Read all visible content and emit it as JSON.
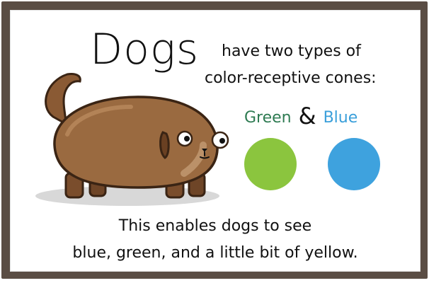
{
  "title": "Dogs",
  "subtitle_lines": [
    "have two types of",
    "color-receptive cones:"
  ],
  "colors": {
    "green_label": "Green",
    "ampersand": "&",
    "blue_label": "Blue",
    "green_hex": "#8bc53e",
    "blue_hex": "#3ea2de"
  },
  "bottom_lines": [
    "This enables dogs to see",
    "blue, green, and a little bit of yellow."
  ]
}
